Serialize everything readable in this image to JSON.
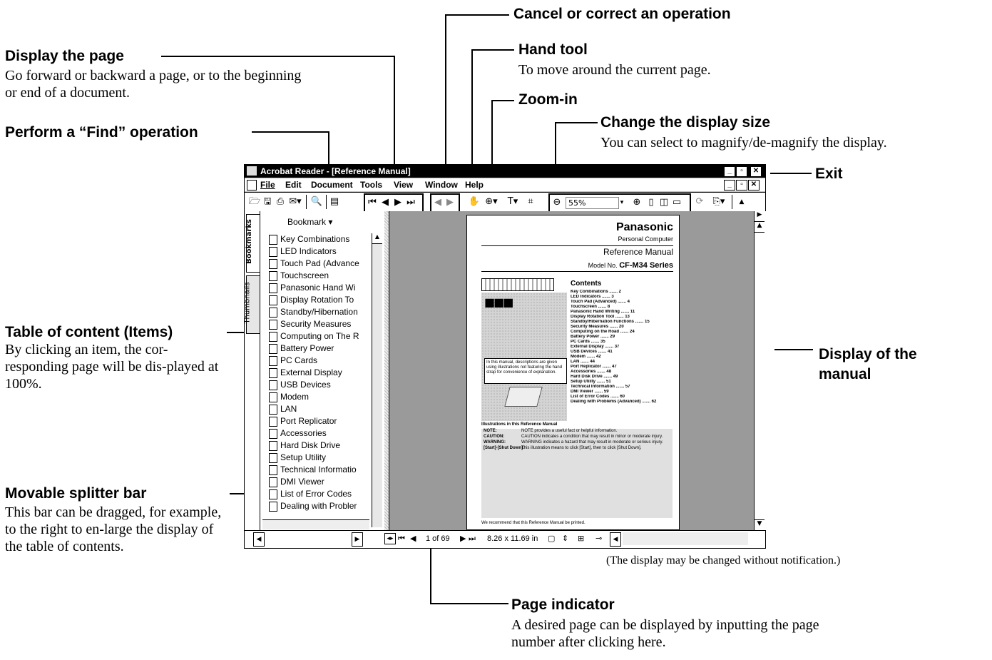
{
  "annotations": {
    "display_page": {
      "title": "Display the page",
      "body": "Go forward or backward a page, or to the beginning or end of a document."
    },
    "find": {
      "title": "Perform a “Find” operation"
    },
    "cancel": {
      "title": "Cancel or correct an operation"
    },
    "hand": {
      "title": "Hand tool",
      "body": "To move around the current page."
    },
    "zoom": {
      "title": "Zoom-in"
    },
    "display_size": {
      "title": "Change the display size",
      "body": "You can select to magnify/de-magnify the display."
    },
    "exit": {
      "title": "Exit"
    },
    "toc": {
      "title": "Table of content (Items)",
      "body": "By clicking an item, the cor-responding page will be dis-played at 100%."
    },
    "manual": {
      "title": "Display of the manual"
    },
    "splitter": {
      "title": "Movable splitter bar",
      "body": "This bar can be dragged, for example, to the right to en-large the display of the table of contents."
    },
    "note": "(The display may be changed without notification.)",
    "page_indicator": {
      "title": "Page indicator",
      "body": "A desired page can be displayed by inputting the page number after clicking here."
    }
  },
  "window": {
    "title": "Acrobat Reader - [Reference Manual]",
    "menus": [
      "File",
      "Edit",
      "Document",
      "Tools",
      "View",
      "Window",
      "Help"
    ],
    "zoom_value": "55%",
    "tabs": {
      "bookmarks": "Bookmarks",
      "thumbnails": "Thumbnails"
    },
    "bookmark_button": "Bookmark ▾",
    "bookmarks": [
      "Key Combinations",
      "LED Indicators",
      "Touch Pad (Advance",
      "Touchscreen",
      "Panasonic Hand Wi",
      "Display Rotation To",
      "Standby/Hibernation",
      "Security Measures",
      "Computing on The R",
      "Battery Power",
      "PC Cards",
      "External Display",
      "USB Devices",
      "Modem",
      "LAN",
      "Port Replicator",
      "Accessories",
      "Hard Disk Drive",
      "Setup Utility",
      "Technical Informatio",
      "DMI Viewer",
      "List of Error Codes",
      "Dealing with Probler"
    ],
    "status": {
      "page": "1 of 69",
      "size": "8.26 x 11.69 in"
    }
  },
  "page": {
    "brand": "Panasonic",
    "subtitle": "Personal Computer",
    "doc_title": "Reference Manual",
    "model_label": "Model No.",
    "model": "CF-M34 Series",
    "contents_title": "Contents",
    "contents": [
      "Key Combinations ....... 2",
      "LED Indicators ....... 3",
      "Touch Pad (Advanced) ....... 4",
      "Touchscreen ....... 8",
      "Panasonic Hand Writing ....... 11",
      "Display Rotation Tool ....... 13",
      "Standby/Hibernation Functions ....... 15",
      "Security Measures ....... 20",
      "Computing on the Road ....... 24",
      "Battery Power ....... 29",
      "PC Cards ....... 35",
      "External Display ....... 37",
      "USB Devices ....... 41",
      "Modem ....... 42",
      "LAN ....... 44",
      "Port Replicator ....... 47",
      "Accessories ....... 48",
      "Hard Disk Drive ....... 49",
      "Setup Utility ....... 51",
      "Technical Information ....... 57",
      "DMI Viewer ....... 59",
      "List of Error Codes ....... 60",
      "Dealing with Problems (Advanced) ....... 62"
    ],
    "box_note": "In this manual, descriptions are given using illustrations not featuring the hand strap for convenience of explanation.",
    "illus_title": "Illustrations in this Reference Manual",
    "legend": [
      [
        "NOTE:",
        "NOTE provides a useful fact or helpful information."
      ],
      [
        "CAUTION:",
        "CAUTION indicates a condition that may result in minor or moderate injury."
      ],
      [
        "WARNING:",
        "WARNING indicates a hazard that may result in moderate or serious injury."
      ],
      [
        "[Start]-[Shut Down]:",
        "This illustration means to click [Start], then to click [Shut Down]."
      ]
    ],
    "footer": "We recommend that this Reference Manual be printed."
  }
}
